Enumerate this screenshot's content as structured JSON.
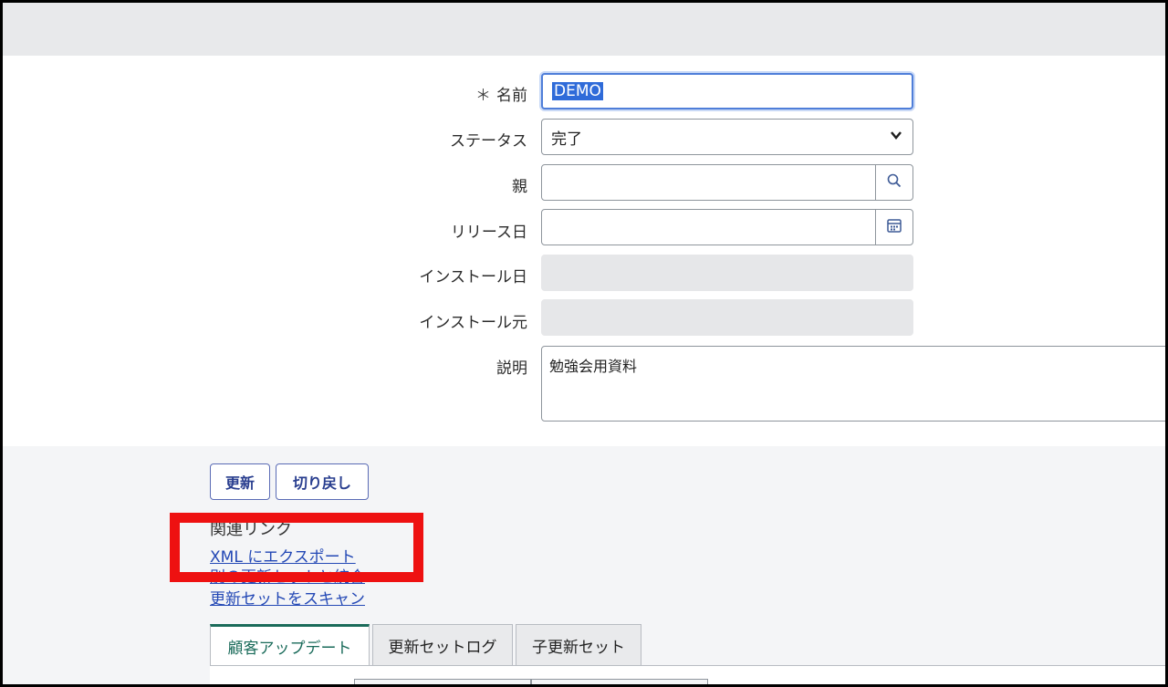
{
  "form": {
    "name_required_mark": "＊",
    "name_label": "名前",
    "name_value": "DEMO",
    "status_label": "ステータス",
    "status_value": "完了",
    "parent_label": "親",
    "parent_value": "",
    "release_date_label": "リリース日",
    "release_date_value": "",
    "install_date_label": "インストール日",
    "installed_from_label": "インストール元",
    "description_label": "説明",
    "description_value": "勉強会用資料"
  },
  "actions": {
    "update_label": "更新",
    "revert_label": "切り戻し"
  },
  "related_links": {
    "title": "関連リンク",
    "links": [
      "XML にエクスポート",
      "別の更新セットと統合",
      "更新セットをスキャン"
    ]
  },
  "tabs": [
    "顧客アップデート",
    "更新セットログ",
    "子更新セット"
  ],
  "colors": {
    "accent_tab": "#1a6b5a",
    "link": "#2348b5",
    "highlight": "#ee1111"
  }
}
